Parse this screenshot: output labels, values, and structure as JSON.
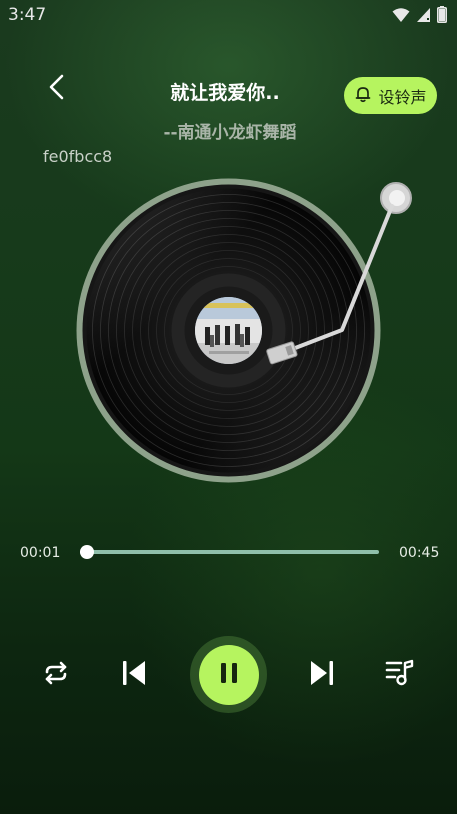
{
  "status_bar": {
    "time": "3:47"
  },
  "header": {
    "title": "就让我爱你..",
    "artist": "--南通小龙虾舞蹈",
    "ringtone_label": "设铃声"
  },
  "uploader_id": "fe0fbcc8",
  "progress": {
    "current": "00:01",
    "total": "00:45",
    "fraction": 0.022
  },
  "colors": {
    "accent": "#b6f45f",
    "track": "#8fbfaa",
    "background_top": "#1a3a1e",
    "background_bottom": "#0a1d0c"
  },
  "icons": {
    "back": "chevron-left-icon",
    "bell": "bell-icon",
    "repeat": "repeat-icon",
    "prev": "skip-previous-icon",
    "pause": "pause-icon",
    "next": "skip-next-icon",
    "playlist": "playlist-music-icon",
    "wifi": "wifi-icon",
    "signal": "signal-icon",
    "battery": "battery-icon"
  }
}
